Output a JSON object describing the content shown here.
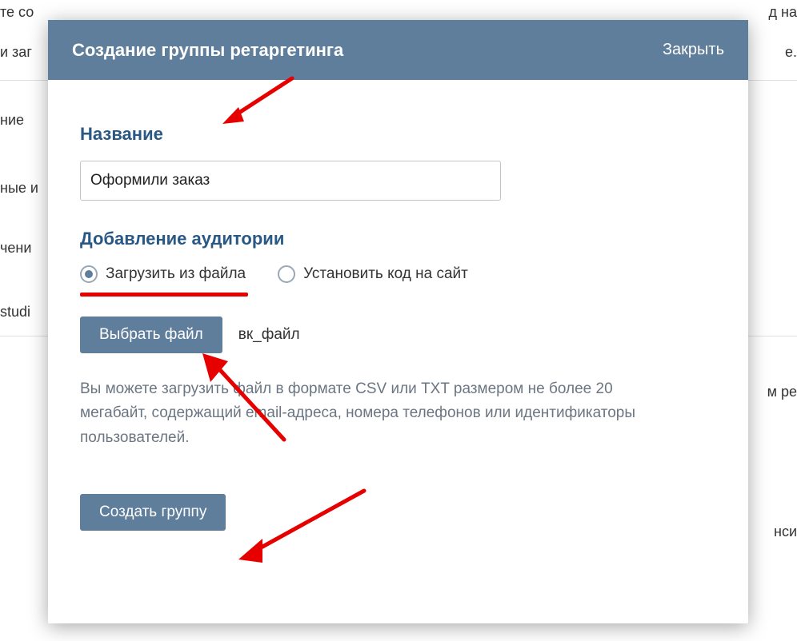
{
  "background": {
    "line1": "те со",
    "line2": "и заг",
    "line3": "ние",
    "line4": "ные и",
    "line5": "чени",
    "line6": "studi",
    "right1": "д на",
    "right2": "е.",
    "right3": "м ре",
    "right4": "нси"
  },
  "modal": {
    "title": "Создание группы ретаргетинга",
    "close_label": "Закрыть",
    "name_section_label": "Название",
    "name_value": "Оформили заказ",
    "audience_section_label": "Добавление аудитории",
    "radio_upload_label": "Загрузить из файла",
    "radio_code_label": "Установить код на сайт",
    "choose_file_label": "Выбрать файл",
    "chosen_file_name": "вк_файл",
    "hint_text": "Вы можете загрузить файл в формате CSV или TXT размером не более 20 мегабайт, содержащий email-адреса, номера телефонов или идентификаторы пользователей.",
    "create_label": "Создать группу"
  }
}
